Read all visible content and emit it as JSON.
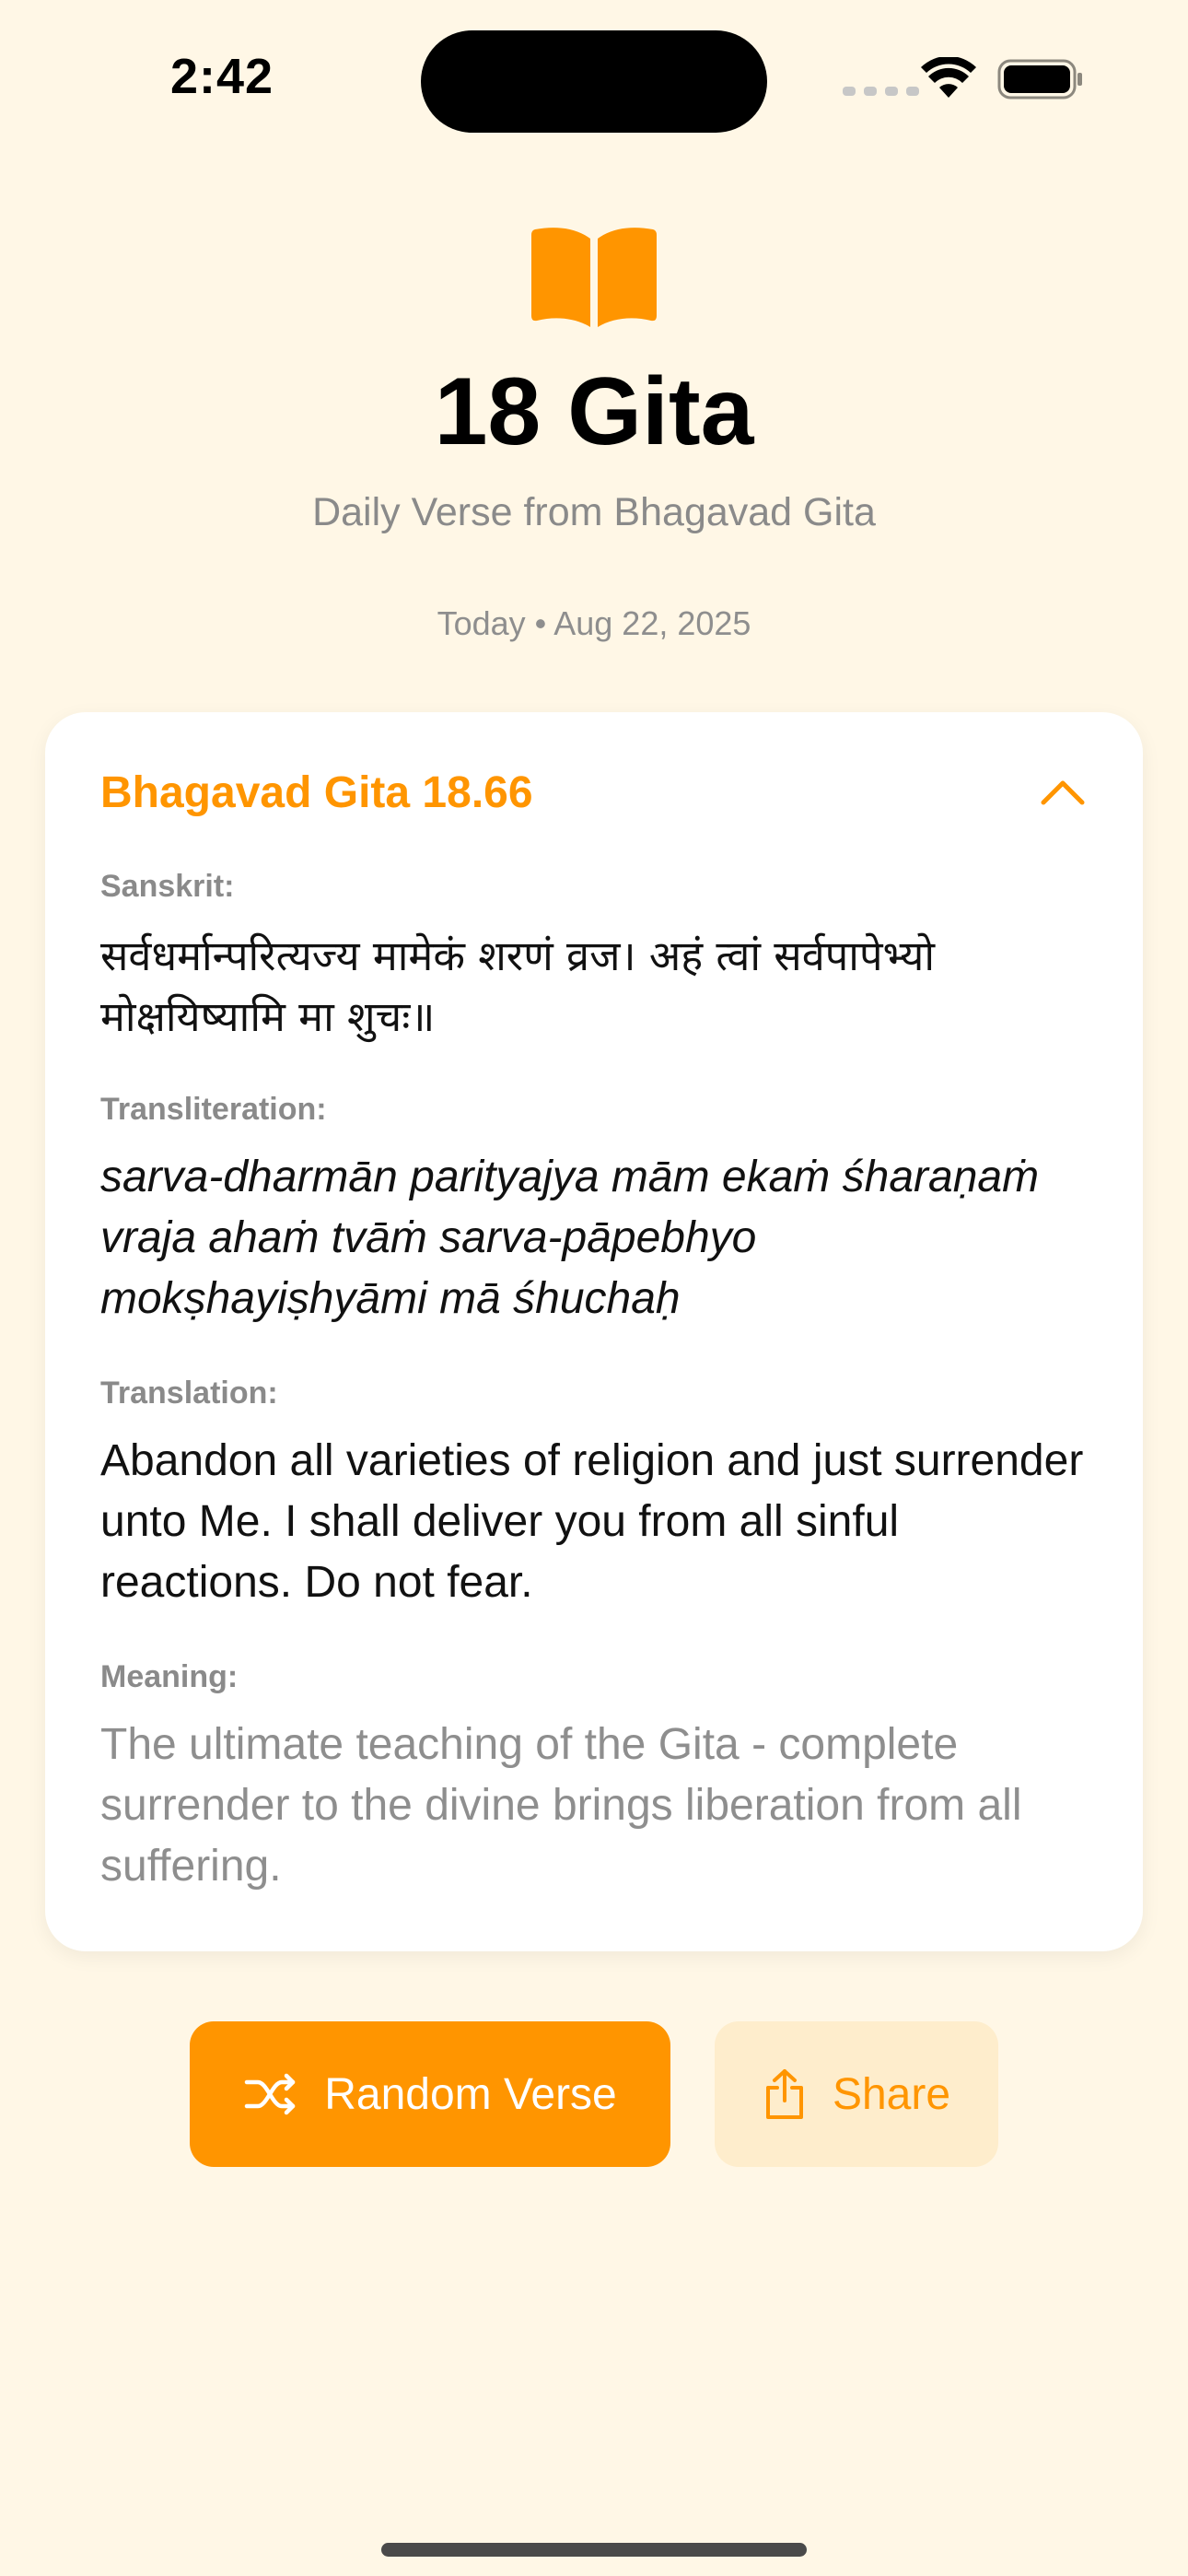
{
  "status_bar": {
    "time": "2:42"
  },
  "header": {
    "icon": "book-open-icon",
    "title": "18 Gita",
    "subtitle": "Daily Verse from Bhagavad Gita",
    "date_line": "Today • Aug 22, 2025"
  },
  "verse": {
    "reference": "Bhagavad Gita 18.66",
    "collapse_icon": "chevron-up-icon",
    "sanskrit_label": "Sanskrit:",
    "sanskrit": "सर्वधर्मान्परित्यज्य मामेकं शरणं व्रज। अहं त्वां सर्वपापेभ्यो मोक्षयिष्यामि मा शुचः॥",
    "transliteration_label": "Transliteration:",
    "transliteration": "sarva-dharmān parityajya mām ekaṁ śharaṇaṁ vraja ahaṁ tvāṁ sarva-pāpebhyo mokṣhayiṣhyāmi mā śhuchaḥ",
    "translation_label": "Translation:",
    "translation": "Abandon all varieties of religion and just surrender unto Me. I shall deliver you from all sinful reactions. Do not fear.",
    "meaning_label": "Meaning:",
    "meaning": "The ultimate teaching of the Gita - complete surrender to the divine brings liberation from all suffering."
  },
  "actions": {
    "random_label": "Random Verse",
    "random_icon": "shuffle-icon",
    "share_label": "Share",
    "share_icon": "share-icon"
  },
  "colors": {
    "accent": "#FF9500",
    "background": "#FFF7E6",
    "share_bg": "#FEEDCC"
  }
}
